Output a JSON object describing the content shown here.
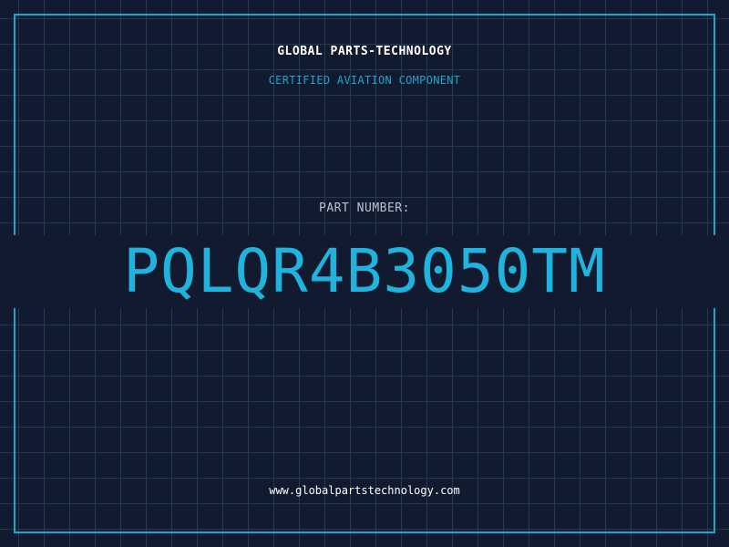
{
  "header": {
    "company": "GLOBAL PARTS-TECHNOLOGY",
    "subtitle": "CERTIFIED AVIATION COMPONENT"
  },
  "part": {
    "label": "PART NUMBER:",
    "number": "PQLQR4B3050TM"
  },
  "footer": {
    "website": "www.globalpartstechnology.com"
  },
  "colors": {
    "background": "#111a2e",
    "grid": "#1d3d55",
    "accent": "#1fa6cc",
    "part_number": "#1fb3dd",
    "text": "#ffffff"
  }
}
